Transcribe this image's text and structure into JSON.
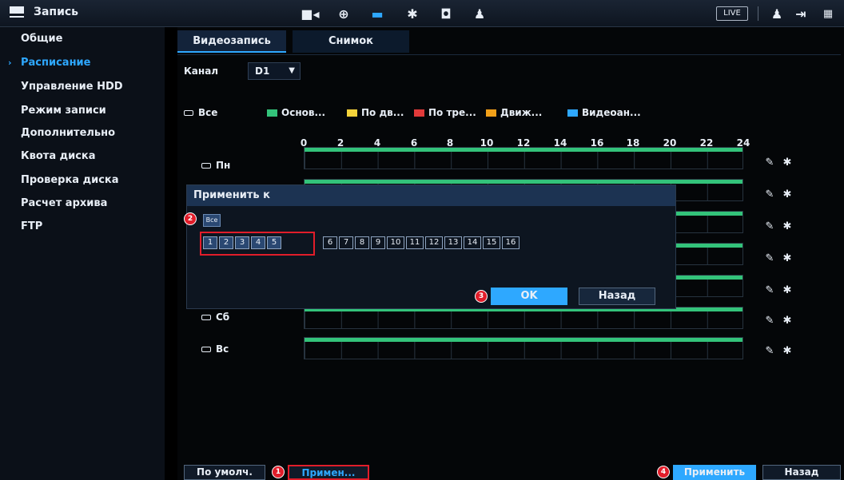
{
  "header": {
    "title": "Запись",
    "live_label": "LIVE",
    "icons": [
      "camera-icon",
      "network-icon",
      "storage-icon",
      "settings-icon",
      "security-icon",
      "account-icon"
    ]
  },
  "sidebar": {
    "items": [
      {
        "label": "Общие"
      },
      {
        "label": "Расписание"
      },
      {
        "label": "Управление HDD"
      },
      {
        "label": "Режим записи"
      },
      {
        "label": "Дополнительно"
      },
      {
        "label": "Квота диска"
      },
      {
        "label": "Проверка диска"
      },
      {
        "label": "Расчет архива"
      },
      {
        "label": "FTP"
      }
    ],
    "selected": "Расписание"
  },
  "tabs": [
    {
      "label": "Видеозапись"
    },
    {
      "label": "Снимок"
    }
  ],
  "channel": {
    "label": "Канал",
    "value": "D1"
  },
  "legend": {
    "all_label": "Все",
    "items": [
      {
        "label": "Основ...",
        "color": "#33c37a"
      },
      {
        "label": "По дв...",
        "color": "#f5d33a"
      },
      {
        "label": "По тре...",
        "color": "#e23a3a"
      },
      {
        "label": "Движ...",
        "color": "#f2a019"
      },
      {
        "label": "Видеоан...",
        "color": "#2ea8ff"
      }
    ]
  },
  "timeline": {
    "ticks": [
      "0",
      "2",
      "4",
      "6",
      "8",
      "10",
      "12",
      "14",
      "16",
      "18",
      "20",
      "22",
      "24"
    ]
  },
  "days": {
    "mon": "Пн",
    "sat": "Сб",
    "sun": "Вс"
  },
  "dialog": {
    "title": "Применить к",
    "all_label": "Все",
    "channels": [
      "1",
      "2",
      "3",
      "4",
      "5",
      "6",
      "7",
      "8",
      "9",
      "10",
      "11",
      "12",
      "13",
      "14",
      "15",
      "16"
    ],
    "ok_label": "OK",
    "back_label": "Назад"
  },
  "callouts": [
    "1",
    "2",
    "3",
    "4"
  ],
  "footer": {
    "default_label": "По умолч.",
    "copy_label": "Примен...",
    "apply_label": "Применить",
    "back_label": "Назад"
  },
  "colors": {
    "accent": "#2ea8ff",
    "schedule": "#33c37a",
    "highlight": "#e11d2a"
  }
}
